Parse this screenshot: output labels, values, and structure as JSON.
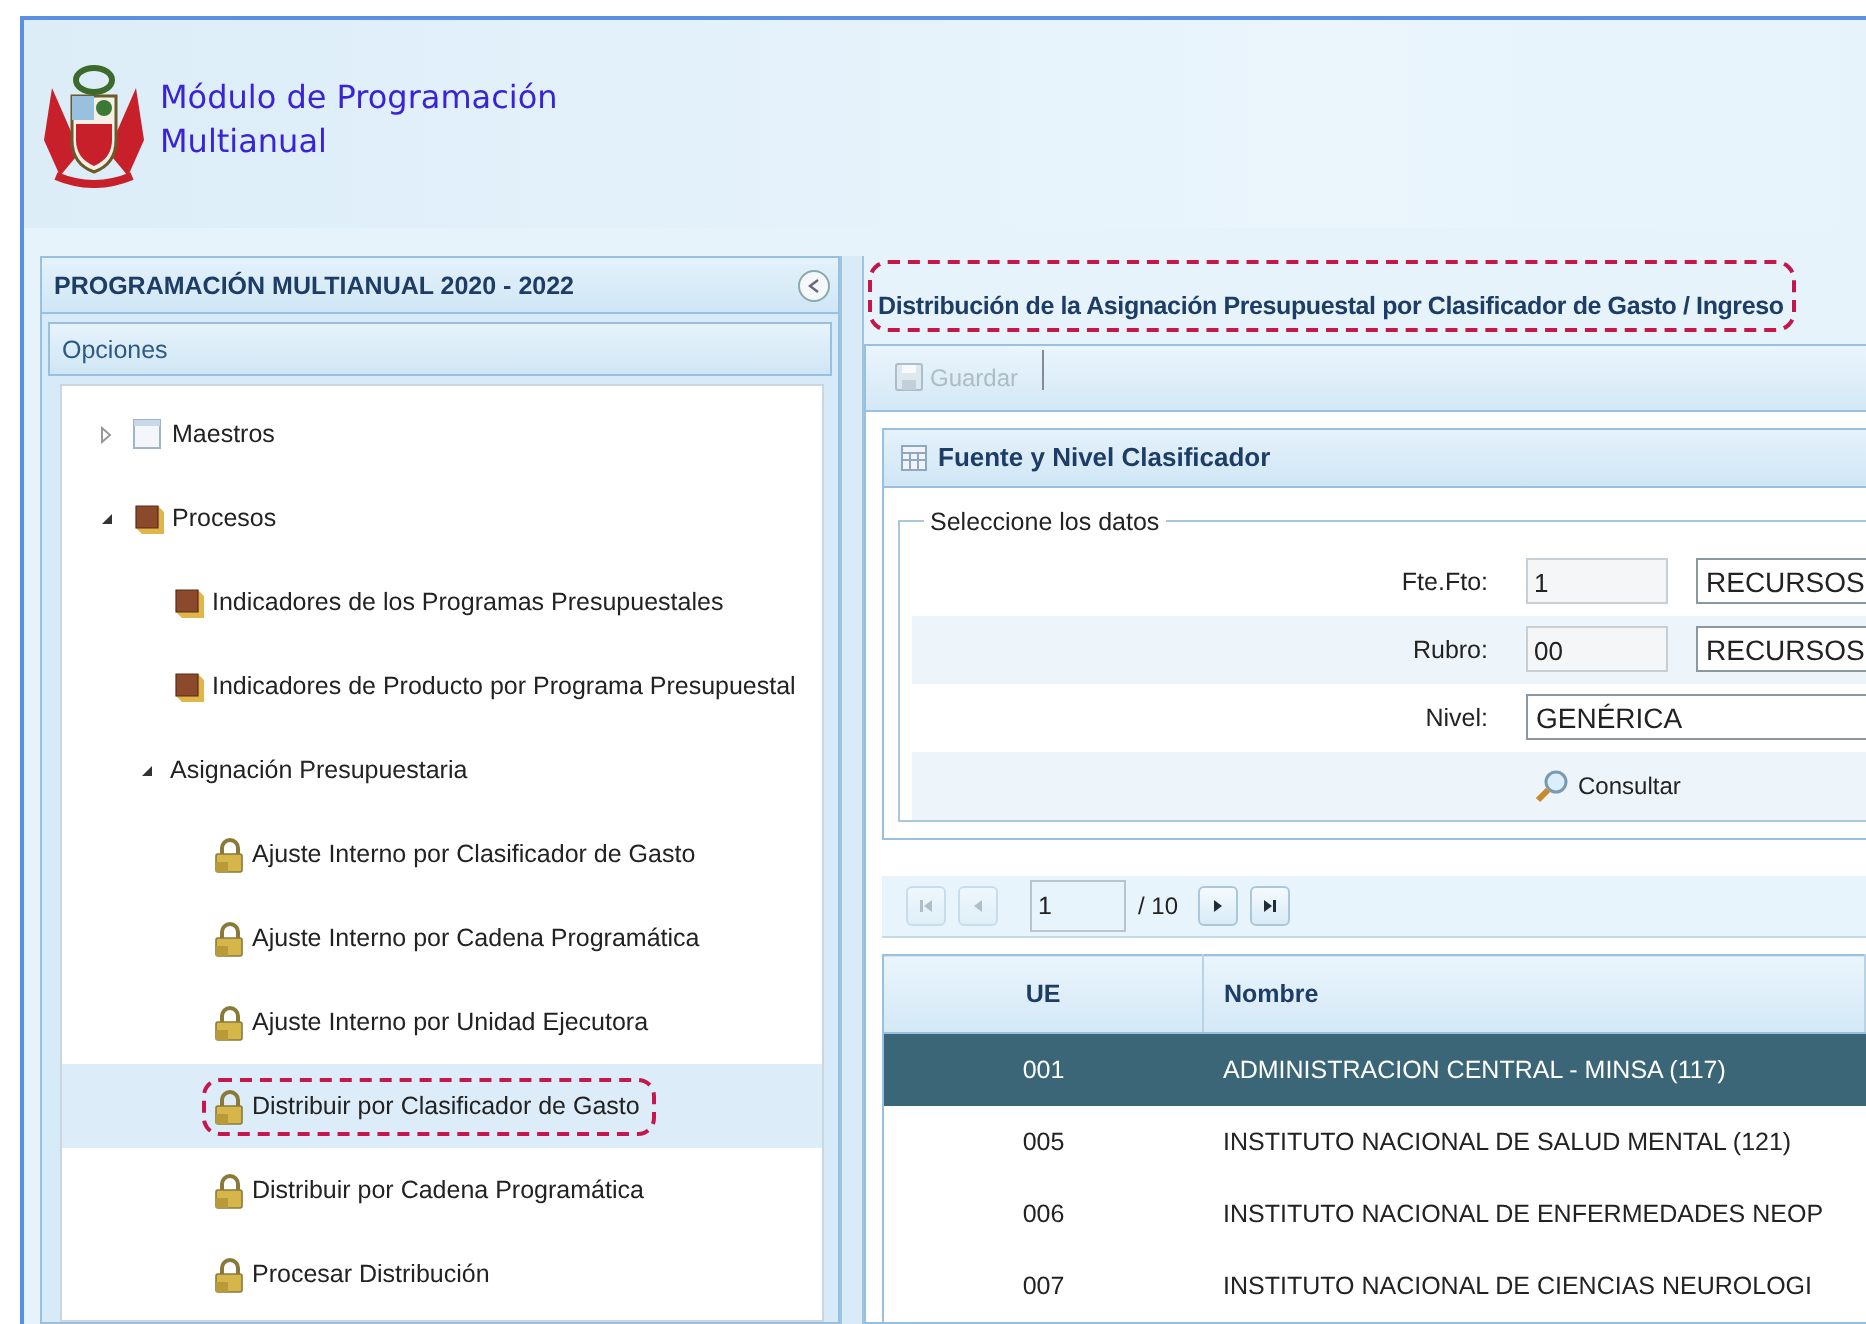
{
  "header": {
    "title": "Módulo de Programación Multianual"
  },
  "nav": {
    "title": "PROGRAMACIÓN MULTIANUAL 2020 - 2022",
    "section": "Opciones",
    "tree": [
      {
        "label": "Maestros",
        "kind": "page",
        "expanded": false,
        "selected": false,
        "callout": false
      },
      {
        "label": "Procesos",
        "kind": "book",
        "expanded": true,
        "selected": false,
        "callout": false,
        "children": [
          {
            "label": "Indicadores de los Programas Presupuestales",
            "kind": "book",
            "selected": false,
            "callout": false
          },
          {
            "label": "Indicadores de Producto por Programa Presupuestal",
            "kind": "book",
            "selected": false,
            "callout": false
          },
          {
            "label": "Asignación Presupuestaria",
            "kind": "group",
            "expanded": true,
            "selected": false,
            "callout": false,
            "children": [
              {
                "label": "Ajuste Interno por Clasificador de Gasto",
                "kind": "lock",
                "selected": false,
                "callout": false
              },
              {
                "label": "Ajuste Interno por Cadena Programática",
                "kind": "lock",
                "selected": false,
                "callout": false
              },
              {
                "label": "Ajuste Interno por Unidad Ejecutora",
                "kind": "lock",
                "selected": false,
                "callout": false
              },
              {
                "label": "Distribuir por Clasificador de Gasto",
                "kind": "lock",
                "selected": true,
                "callout": true
              },
              {
                "label": "Distribuir por Cadena Programática",
                "kind": "lock",
                "selected": false,
                "callout": false
              },
              {
                "label": "Procesar Distribución",
                "kind": "lock",
                "selected": false,
                "callout": false
              }
            ]
          }
        ]
      }
    ]
  },
  "main": {
    "title": "Distribución de la Asignación Presupuestal por Clasificador de Gasto / Ingreso",
    "title_callout": true,
    "toolbar": [
      {
        "label": "Guardar",
        "disabled": true
      }
    ],
    "form": {
      "title": "Fuente y Nivel Clasificador",
      "legend": "Seleccione los datos",
      "rows": [
        {
          "kind": "code-select",
          "label": "Fte.Fto:",
          "code": "1",
          "option": "RECURSOS"
        },
        {
          "kind": "code-select",
          "label": "Rubro:",
          "code": "00",
          "option": "RECURSOS"
        },
        {
          "kind": "select",
          "label": "Nivel:",
          "option": "GENÉRICA"
        },
        {
          "kind": "button",
          "label": "Consultar"
        }
      ]
    },
    "pager": {
      "page": "1",
      "total": "/ 10",
      "buttons": [
        {
          "kind": "first",
          "disabled": true
        },
        {
          "kind": "prev",
          "disabled": true
        },
        {
          "kind": "next",
          "disabled": false
        },
        {
          "kind": "last",
          "disabled": false
        }
      ]
    },
    "table": {
      "columns": [
        "UE",
        "Nombre"
      ],
      "rows": [
        {
          "cells": [
            "001",
            "ADMINISTRACION CENTRAL - MINSA (117)"
          ],
          "selected": true
        },
        {
          "cells": [
            "005",
            "INSTITUTO NACIONAL DE SALUD MENTAL (121)"
          ],
          "selected": false
        },
        {
          "cells": [
            "006",
            "INSTITUTO NACIONAL DE ENFERMEDADES NEOP"
          ],
          "selected": false
        },
        {
          "cells": [
            "007",
            "INSTITUTO NACIONAL DE CIENCIAS NEUROLOGI"
          ],
          "selected": false
        }
      ]
    }
  }
}
